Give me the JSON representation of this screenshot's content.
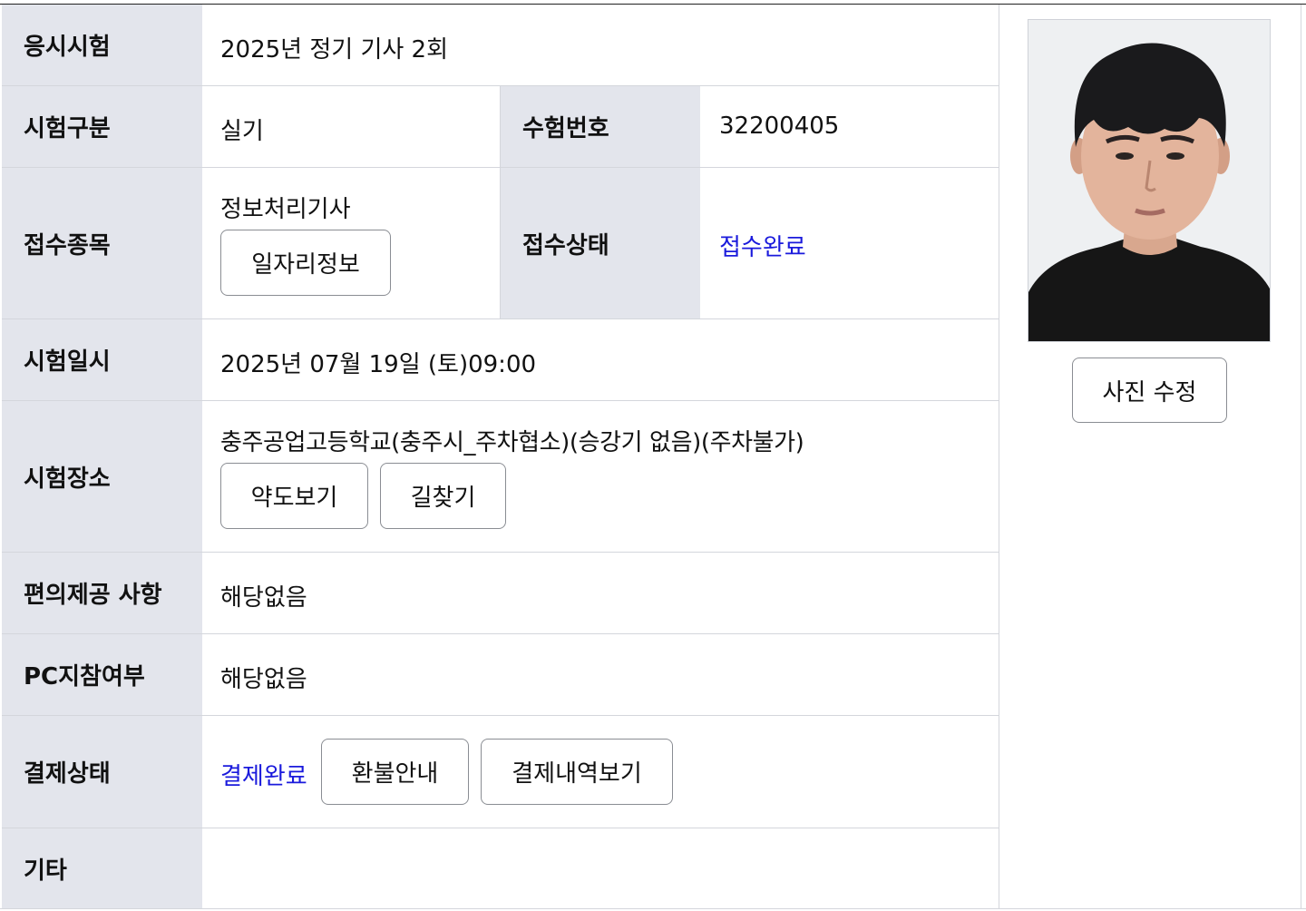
{
  "rows": {
    "exam": {
      "label": "응시시험",
      "value": "2025년 정기 기사 2회"
    },
    "exam_type": {
      "label": "시험구분",
      "value": "실기"
    },
    "exam_number": {
      "label": "수험번호",
      "value": "32200405"
    },
    "subject": {
      "label": "접수종목",
      "value": "정보처리기사",
      "button": "일자리정보"
    },
    "status": {
      "label": "접수상태",
      "value": "접수완료"
    },
    "datetime": {
      "label": "시험일시",
      "value": "2025년 07월 19일 (토)09:00"
    },
    "place": {
      "label": "시험장소",
      "value": "충주공업고등학교(충주시_주차협소)(승강기 없음)(주차불가)",
      "map_button": "약도보기",
      "route_button": "길찾기"
    },
    "convenience": {
      "label": "편의제공 사항",
      "value": "해당없음"
    },
    "pc": {
      "label": "PC지참여부",
      "value": "해당없음"
    },
    "payment": {
      "label": "결제상태",
      "value": "결제완료",
      "refund_button": "환불안내",
      "history_button": "결제내역보기"
    },
    "etc": {
      "label": "기타",
      "value": ""
    }
  },
  "photo": {
    "edit_button": "사진 수정"
  },
  "colors": {
    "header_bg": "#e3e5ec",
    "status_blue": "#1a1adc",
    "border": "#d4d6dc"
  }
}
